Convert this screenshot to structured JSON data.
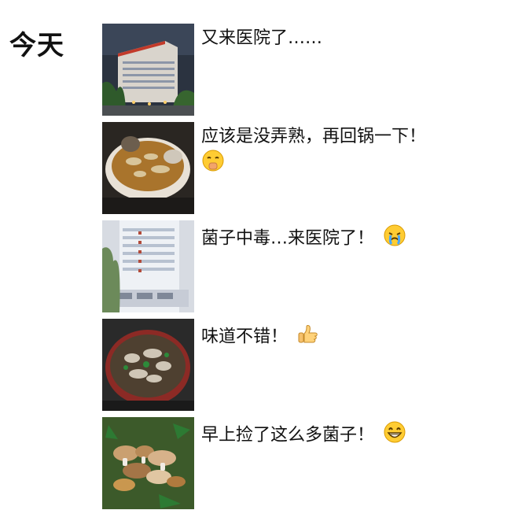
{
  "day_label": "今天",
  "posts": [
    {
      "text": "又来医院了……",
      "image": "hospital-night-photo"
    },
    {
      "text": "应该是没弄熟，再回锅一下！",
      "emoji": "shush-face-emoji",
      "image": "mushroom-soup-pot-photo"
    },
    {
      "text": "菌子中毒…来医院了！",
      "emoji": "crying-face-emoji",
      "image": "hospital-building-photo"
    },
    {
      "text": "味道不错！",
      "emoji": "thumbs-up-emoji",
      "image": "mushroom-hotpot-photo"
    },
    {
      "text": "早上捡了这么多菌子！",
      "emoji": "grinning-face-emoji",
      "image": "wild-mushrooms-photo"
    }
  ]
}
